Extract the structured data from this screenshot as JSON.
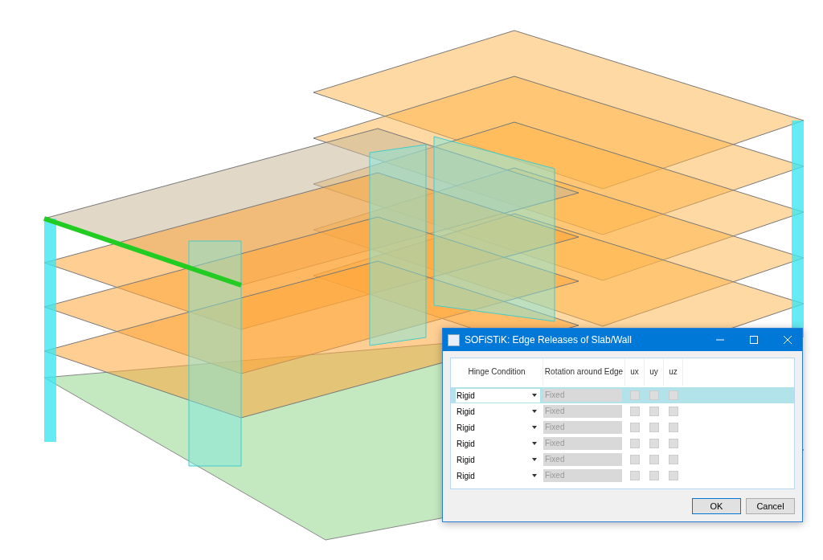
{
  "dialog": {
    "title": "SOFiSTiK: Edge Releases of Slab/Wall",
    "columns": [
      "Hinge Condition",
      "Rotation around Edge",
      "ux",
      "uy",
      "uz"
    ],
    "rows": [
      {
        "hinge": "Rigid",
        "rotation": "Fixed",
        "selected": true,
        "ux": false,
        "uy": false,
        "uz": false
      },
      {
        "hinge": "Rigid",
        "rotation": "Fixed",
        "selected": false,
        "ux": false,
        "uy": false,
        "uz": false
      },
      {
        "hinge": "Rigid",
        "rotation": "Fixed",
        "selected": false,
        "ux": false,
        "uy": false,
        "uz": false
      },
      {
        "hinge": "Rigid",
        "rotation": "Fixed",
        "selected": false,
        "ux": false,
        "uy": false,
        "uz": false
      },
      {
        "hinge": "Rigid",
        "rotation": "Fixed",
        "selected": false,
        "ux": false,
        "uy": false,
        "uz": false
      },
      {
        "hinge": "Rigid",
        "rotation": "Fixed",
        "selected": false,
        "ux": false,
        "uy": false,
        "uz": false
      }
    ],
    "buttons": [
      "OK",
      "Cancel"
    ]
  }
}
